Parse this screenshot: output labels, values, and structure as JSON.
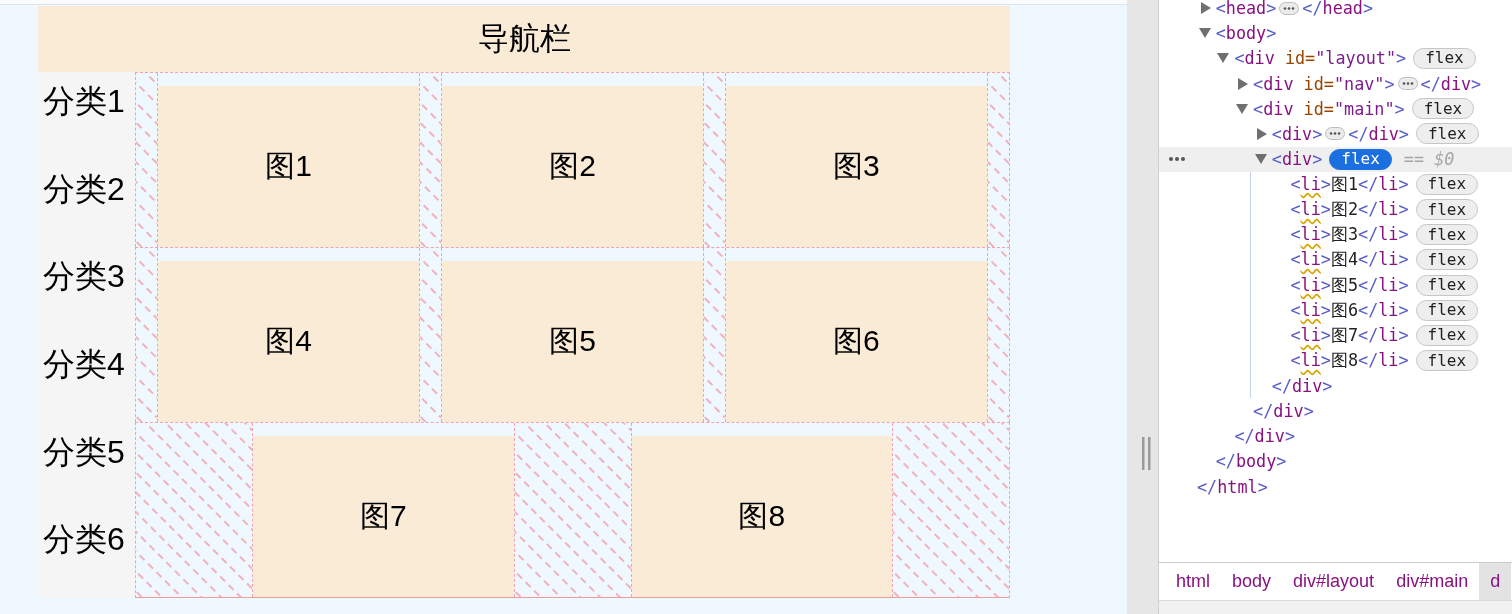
{
  "viewport": {
    "nav": {
      "title": "导航栏"
    },
    "sidebar": {
      "items": [
        "分类1",
        "分类2",
        "分类3",
        "分类4",
        "分类5",
        "分类6"
      ]
    },
    "flex_lines": [
      [
        "图1",
        "图2",
        "图3"
      ],
      [
        "图4",
        "图5",
        "图6"
      ],
      [
        "图7",
        "图8"
      ]
    ]
  },
  "devtools": {
    "elements_tree": {
      "nodes": [
        {
          "kind": "element",
          "expanded": false,
          "selected": false,
          "warning": false,
          "open": [
            {
              "kind": "bracket",
              "text": "<"
            },
            {
              "kind": "tag",
              "text": "head"
            },
            {
              "kind": "bracket",
              "text": ">"
            }
          ],
          "close": [
            {
              "kind": "bracket",
              "text": "</"
            },
            {
              "kind": "tag",
              "text": "head"
            },
            {
              "kind": "bracket",
              "text": ">"
            }
          ]
        },
        {
          "kind": "element",
          "expanded": true,
          "selected": false,
          "warning": false,
          "open": [
            {
              "kind": "bracket",
              "text": "<"
            },
            {
              "kind": "tag",
              "text": "body"
            },
            {
              "kind": "bracket",
              "text": ">"
            }
          ],
          "children": [
            {
              "kind": "element",
              "expanded": true,
              "selected": false,
              "warning": false,
              "open": [
                {
                  "kind": "bracket",
                  "text": "<"
                },
                {
                  "kind": "tag",
                  "text": "div"
                },
                {
                  "kind": "attr",
                  "text": " id="
                },
                {
                  "kind": "value",
                  "text": "\"layout\""
                },
                {
                  "kind": "bracket",
                  "text": ">"
                }
              ],
              "badge": {
                "label": "flex",
                "active": false
              },
              "children": [
                {
                  "kind": "element",
                  "expanded": false,
                  "selected": false,
                  "warning": false,
                  "open": [
                    {
                      "kind": "bracket",
                      "text": "<"
                    },
                    {
                      "kind": "tag",
                      "text": "div"
                    },
                    {
                      "kind": "attr",
                      "text": " id="
                    },
                    {
                      "kind": "value",
                      "text": "\"nav\""
                    },
                    {
                      "kind": "bracket",
                      "text": ">"
                    }
                  ],
                  "close": [
                    {
                      "kind": "bracket",
                      "text": "</"
                    },
                    {
                      "kind": "tag",
                      "text": "div"
                    },
                    {
                      "kind": "bracket",
                      "text": ">"
                    }
                  ]
                },
                {
                  "kind": "element",
                  "expanded": true,
                  "selected": false,
                  "warning": false,
                  "open": [
                    {
                      "kind": "bracket",
                      "text": "<"
                    },
                    {
                      "kind": "tag",
                      "text": "div"
                    },
                    {
                      "kind": "attr",
                      "text": " id="
                    },
                    {
                      "kind": "value",
                      "text": "\"main\""
                    },
                    {
                      "kind": "bracket",
                      "text": ">"
                    }
                  ],
                  "badge": {
                    "label": "flex",
                    "active": false
                  },
                  "children": [
                    {
                      "kind": "element",
                      "expanded": false,
                      "selected": false,
                      "warning": false,
                      "open": [
                        {
                          "kind": "bracket",
                          "text": "<"
                        },
                        {
                          "kind": "tag",
                          "text": "div"
                        },
                        {
                          "kind": "bracket",
                          "text": ">"
                        }
                      ],
                      "close": [
                        {
                          "kind": "bracket",
                          "text": "</"
                        },
                        {
                          "kind": "tag",
                          "text": "div"
                        },
                        {
                          "kind": "bracket",
                          "text": ">"
                        }
                      ],
                      "badge": {
                        "label": "flex",
                        "active": false
                      }
                    },
                    {
                      "kind": "element",
                      "expanded": true,
                      "selected": true,
                      "warning": false,
                      "open": [
                        {
                          "kind": "bracket",
                          "text": "<"
                        },
                        {
                          "kind": "tag",
                          "text": "div"
                        },
                        {
                          "kind": "bracket",
                          "text": ">"
                        }
                      ],
                      "badge": {
                        "label": "flex",
                        "active": true
                      },
                      "hint": "== $0",
                      "children": [
                        {
                          "kind": "leaf",
                          "selected": false,
                          "warning": true,
                          "open": [
                            {
                              "kind": "bracket",
                              "text": "<"
                            },
                            {
                              "kind": "tag",
                              "text": "li"
                            },
                            {
                              "kind": "bracket",
                              "text": ">"
                            }
                          ],
                          "content": "图1",
                          "close": [
                            {
                              "kind": "bracket",
                              "text": "</"
                            },
                            {
                              "kind": "tag",
                              "text": "li"
                            },
                            {
                              "kind": "bracket",
                              "text": ">"
                            }
                          ],
                          "badge": {
                            "label": "flex",
                            "active": false
                          }
                        },
                        {
                          "kind": "leaf",
                          "selected": false,
                          "warning": true,
                          "open": [
                            {
                              "kind": "bracket",
                              "text": "<"
                            },
                            {
                              "kind": "tag",
                              "text": "li"
                            },
                            {
                              "kind": "bracket",
                              "text": ">"
                            }
                          ],
                          "content": "图2",
                          "close": [
                            {
                              "kind": "bracket",
                              "text": "</"
                            },
                            {
                              "kind": "tag",
                              "text": "li"
                            },
                            {
                              "kind": "bracket",
                              "text": ">"
                            }
                          ],
                          "badge": {
                            "label": "flex",
                            "active": false
                          }
                        },
                        {
                          "kind": "leaf",
                          "selected": false,
                          "warning": true,
                          "open": [
                            {
                              "kind": "bracket",
                              "text": "<"
                            },
                            {
                              "kind": "tag",
                              "text": "li"
                            },
                            {
                              "kind": "bracket",
                              "text": ">"
                            }
                          ],
                          "content": "图3",
                          "close": [
                            {
                              "kind": "bracket",
                              "text": "</"
                            },
                            {
                              "kind": "tag",
                              "text": "li"
                            },
                            {
                              "kind": "bracket",
                              "text": ">"
                            }
                          ],
                          "badge": {
                            "label": "flex",
                            "active": false
                          }
                        },
                        {
                          "kind": "leaf",
                          "selected": false,
                          "warning": true,
                          "open": [
                            {
                              "kind": "bracket",
                              "text": "<"
                            },
                            {
                              "kind": "tag",
                              "text": "li"
                            },
                            {
                              "kind": "bracket",
                              "text": ">"
                            }
                          ],
                          "content": "图4",
                          "close": [
                            {
                              "kind": "bracket",
                              "text": "</"
                            },
                            {
                              "kind": "tag",
                              "text": "li"
                            },
                            {
                              "kind": "bracket",
                              "text": ">"
                            }
                          ],
                          "badge": {
                            "label": "flex",
                            "active": false
                          }
                        },
                        {
                          "kind": "leaf",
                          "selected": false,
                          "warning": true,
                          "open": [
                            {
                              "kind": "bracket",
                              "text": "<"
                            },
                            {
                              "kind": "tag",
                              "text": "li"
                            },
                            {
                              "kind": "bracket",
                              "text": ">"
                            }
                          ],
                          "content": "图5",
                          "close": [
                            {
                              "kind": "bracket",
                              "text": "</"
                            },
                            {
                              "kind": "tag",
                              "text": "li"
                            },
                            {
                              "kind": "bracket",
                              "text": ">"
                            }
                          ],
                          "badge": {
                            "label": "flex",
                            "active": false
                          }
                        },
                        {
                          "kind": "leaf",
                          "selected": false,
                          "warning": true,
                          "open": [
                            {
                              "kind": "bracket",
                              "text": "<"
                            },
                            {
                              "kind": "tag",
                              "text": "li"
                            },
                            {
                              "kind": "bracket",
                              "text": ">"
                            }
                          ],
                          "content": "图6",
                          "close": [
                            {
                              "kind": "bracket",
                              "text": "</"
                            },
                            {
                              "kind": "tag",
                              "text": "li"
                            },
                            {
                              "kind": "bracket",
                              "text": ">"
                            }
                          ],
                          "badge": {
                            "label": "flex",
                            "active": false
                          }
                        },
                        {
                          "kind": "leaf",
                          "selected": false,
                          "warning": true,
                          "open": [
                            {
                              "kind": "bracket",
                              "text": "<"
                            },
                            {
                              "kind": "tag",
                              "text": "li"
                            },
                            {
                              "kind": "bracket",
                              "text": ">"
                            }
                          ],
                          "content": "图7",
                          "close": [
                            {
                              "kind": "bracket",
                              "text": "</"
                            },
                            {
                              "kind": "tag",
                              "text": "li"
                            },
                            {
                              "kind": "bracket",
                              "text": ">"
                            }
                          ],
                          "badge": {
                            "label": "flex",
                            "active": false
                          }
                        },
                        {
                          "kind": "leaf",
                          "selected": false,
                          "warning": true,
                          "open": [
                            {
                              "kind": "bracket",
                              "text": "<"
                            },
                            {
                              "kind": "tag",
                              "text": "li"
                            },
                            {
                              "kind": "bracket",
                              "text": ">"
                            }
                          ],
                          "content": "图8",
                          "close": [
                            {
                              "kind": "bracket",
                              "text": "</"
                            },
                            {
                              "kind": "tag",
                              "text": "li"
                            },
                            {
                              "kind": "bracket",
                              "text": ">"
                            }
                          ],
                          "badge": {
                            "label": "flex",
                            "active": false
                          }
                        }
                      ],
                      "close": [
                        {
                          "kind": "bracket",
                          "text": "</"
                        },
                        {
                          "kind": "tag",
                          "text": "div"
                        },
                        {
                          "kind": "bracket",
                          "text": ">"
                        }
                      ]
                    }
                  ],
                  "close": [
                    {
                      "kind": "bracket",
                      "text": "</"
                    },
                    {
                      "kind": "tag",
                      "text": "div"
                    },
                    {
                      "kind": "bracket",
                      "text": ">"
                    }
                  ]
                }
              ],
              "close": [
                {
                  "kind": "bracket",
                  "text": "</"
                },
                {
                  "kind": "tag",
                  "text": "div"
                },
                {
                  "kind": "bracket",
                  "text": ">"
                }
              ]
            }
          ],
          "close": [
            {
              "kind": "bracket",
              "text": "</"
            },
            {
              "kind": "tag",
              "text": "body"
            },
            {
              "kind": "bracket",
              "text": ">"
            }
          ]
        }
      ],
      "trailing_rows": [
        [
          {
            "kind": "bracket",
            "text": "</"
          },
          {
            "kind": "tag",
            "text": "html"
          },
          {
            "kind": "bracket",
            "text": ">"
          }
        ]
      ]
    },
    "breadcrumbs": [
      {
        "label": "html",
        "selected": false
      },
      {
        "label": "body",
        "selected": false
      },
      {
        "label": "div#layout",
        "selected": false
      },
      {
        "label": "div#main",
        "selected": false
      },
      {
        "label": "d",
        "selected": true
      }
    ]
  }
}
